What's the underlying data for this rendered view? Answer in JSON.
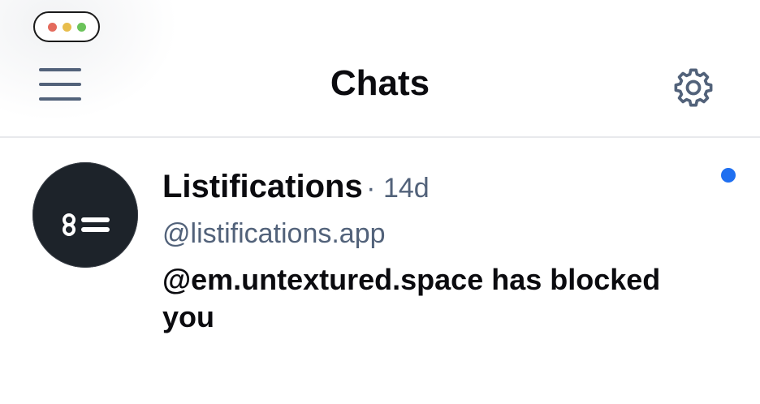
{
  "window": {
    "controls": [
      {
        "name": "close",
        "color": "#e46b5d"
      },
      {
        "name": "minimize",
        "color": "#e8bd4c"
      },
      {
        "name": "maximize",
        "color": "#6bc35a"
      }
    ]
  },
  "header": {
    "title": "Chats",
    "menu_icon": "hamburger-menu-icon",
    "settings_icon": "gear-icon"
  },
  "chats": [
    {
      "name": "Listifications",
      "separator": "·",
      "time": "14d",
      "handle": "@listifications.app",
      "preview": "@em.untextured.space has blocked you",
      "avatar_icon": "list-icon",
      "unread": true
    }
  ],
  "colors": {
    "accent_unread": "#1f6ff0",
    "muted_text": "#52627a",
    "primary_text": "#0b0b0f",
    "avatar_bg": "#1d232a"
  }
}
